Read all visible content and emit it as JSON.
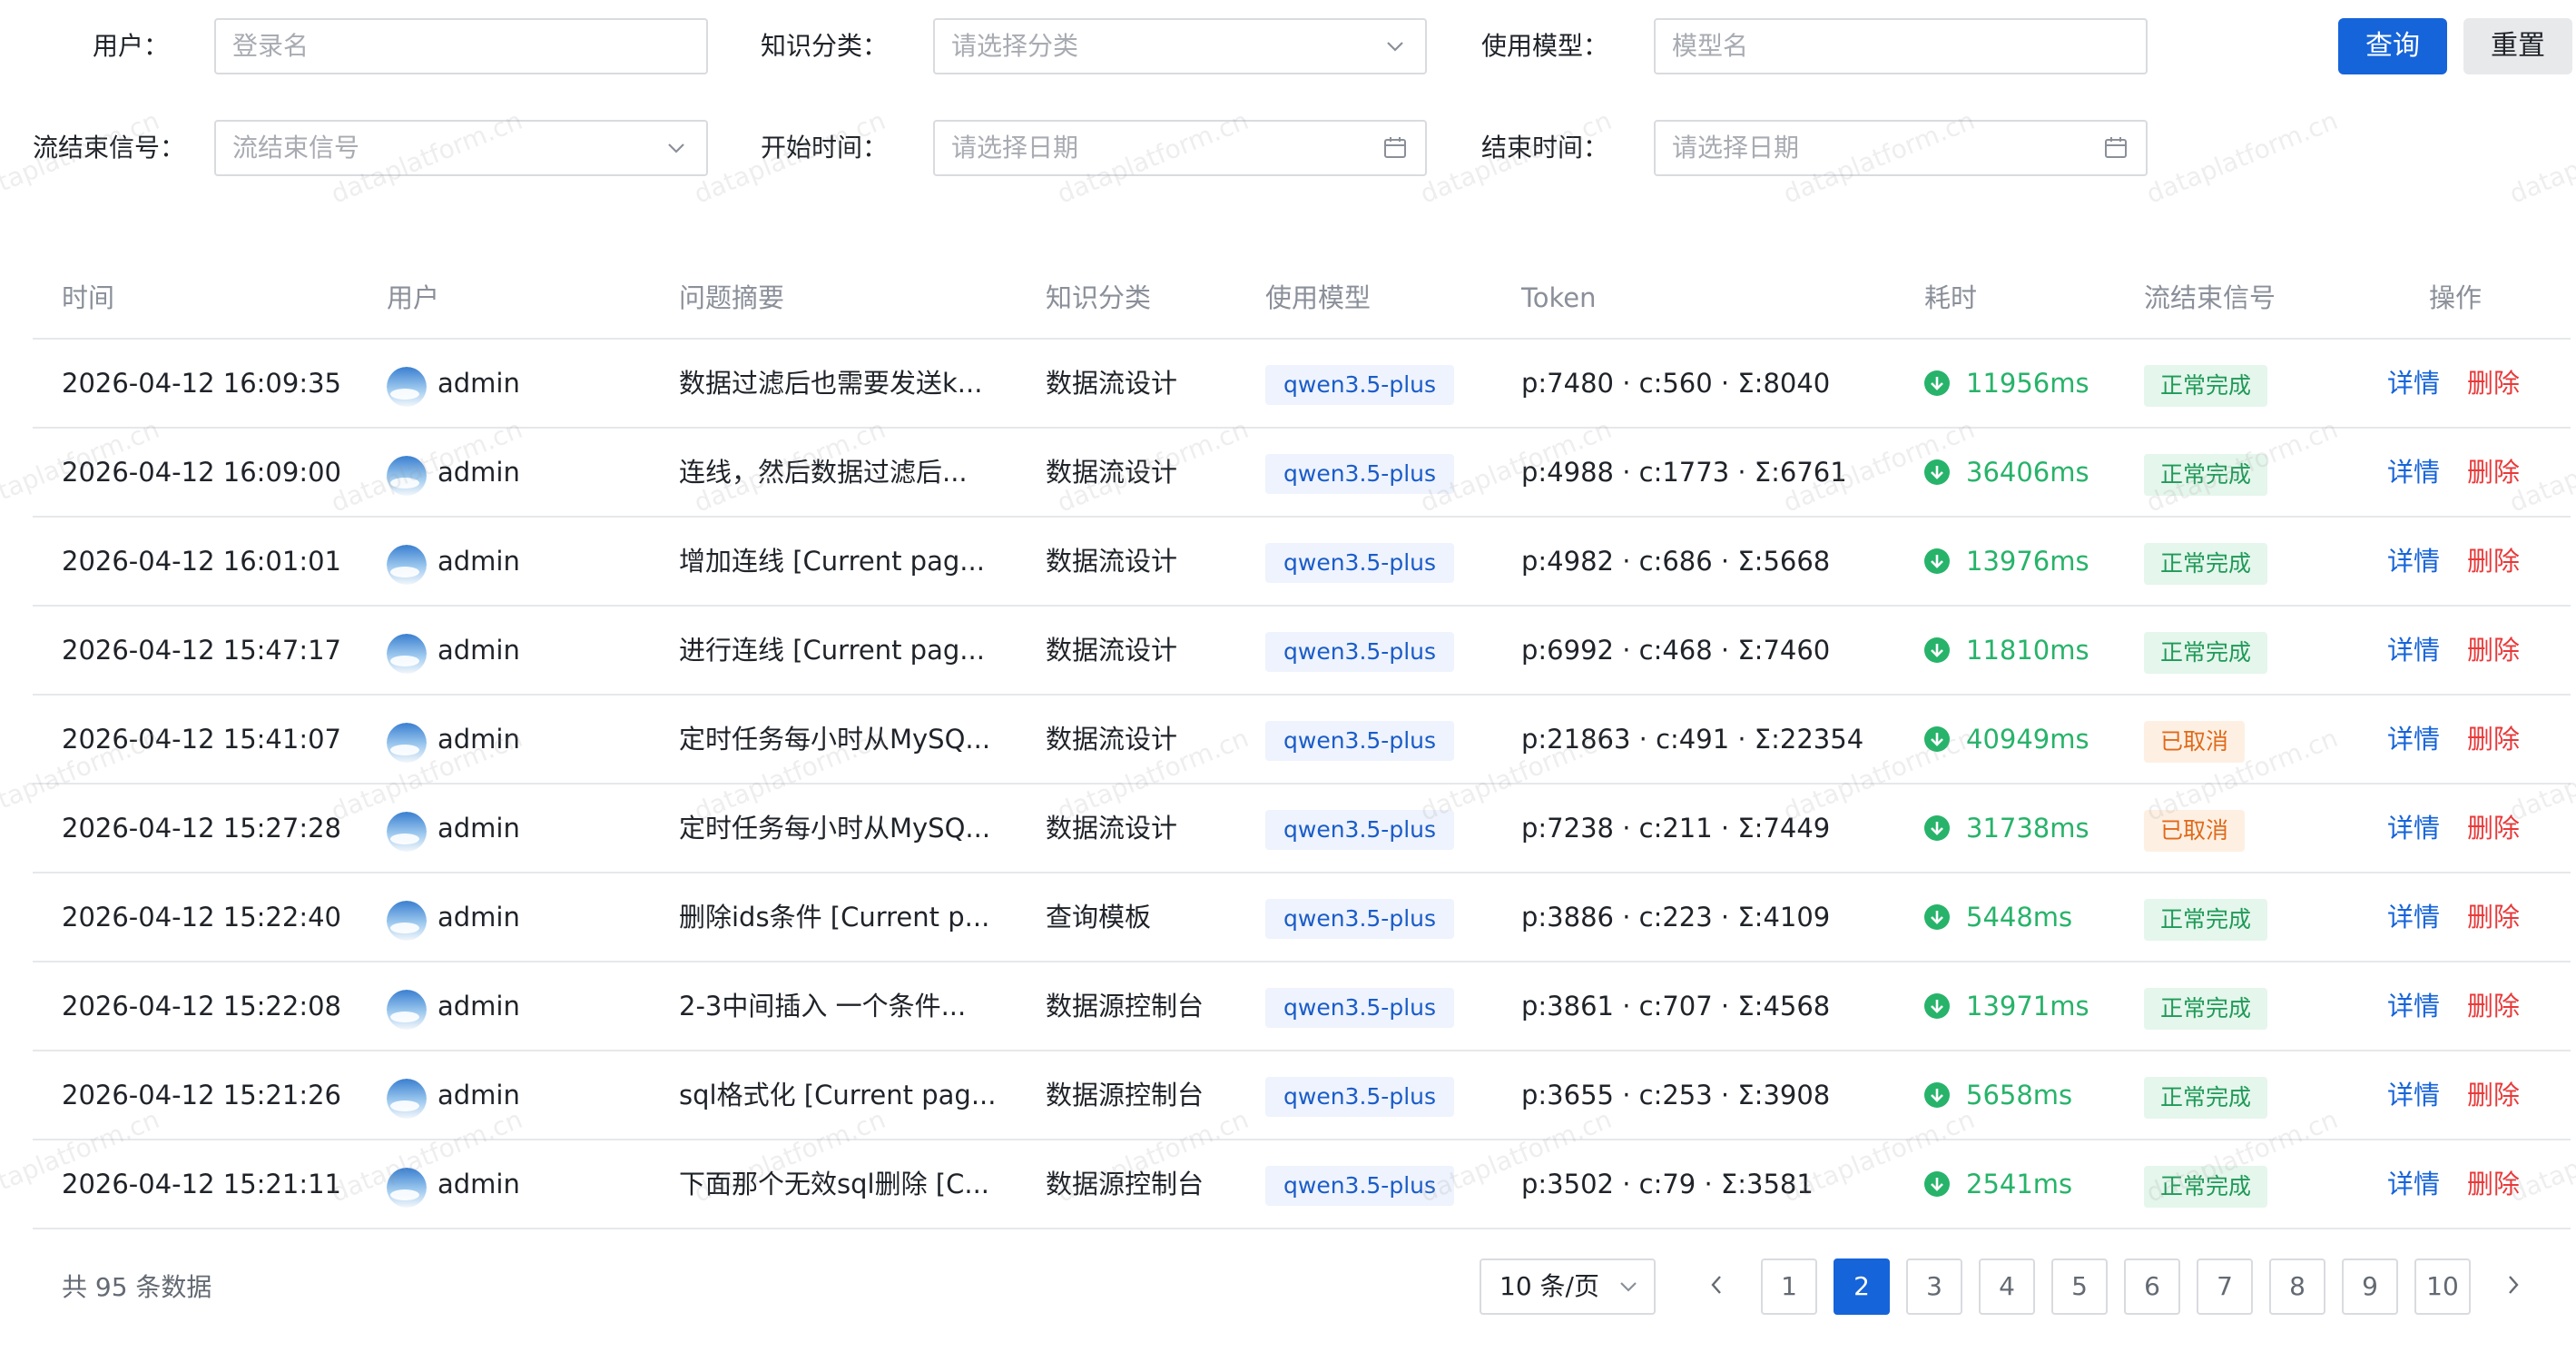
{
  "filters": {
    "user_label": "用户：",
    "user_placeholder": "登录名",
    "category_label": "知识分类：",
    "category_placeholder": "请选择分类",
    "model_label": "使用模型：",
    "model_placeholder": "模型名",
    "query_button": "查询",
    "reset_button": "重置",
    "end_signal_label": "流结束信号：",
    "end_signal_placeholder": "流结束信号",
    "start_time_label": "开始时间：",
    "start_time_placeholder": "请选择日期",
    "end_time_label": "结束时间：",
    "end_time_placeholder": "请选择日期"
  },
  "table": {
    "headers": [
      "时间",
      "用户",
      "问题摘要",
      "知识分类",
      "使用模型",
      "Token",
      "耗时",
      "流结束信号",
      "操作"
    ],
    "action_detail": "详情",
    "action_delete": "删除",
    "rows": [
      {
        "time": "2026-04-12 16:09:35",
        "user": "admin",
        "summary": "数据过滤后也需要发送k...",
        "category": "数据流设计",
        "model": "qwen3.5-plus",
        "token": "p:7480 · c:560 · Σ:8040",
        "duration": "11956ms",
        "status": "正常完成",
        "status_type": "ok"
      },
      {
        "time": "2026-04-12 16:09:00",
        "user": "admin",
        "summary": "连线，然后数据过滤后...",
        "category": "数据流设计",
        "model": "qwen3.5-plus",
        "token": "p:4988 · c:1773 · Σ:6761",
        "duration": "36406ms",
        "status": "正常完成",
        "status_type": "ok"
      },
      {
        "time": "2026-04-12 16:01:01",
        "user": "admin",
        "summary": "增加连线 [Current pag...",
        "category": "数据流设计",
        "model": "qwen3.5-plus",
        "token": "p:4982 · c:686 · Σ:5668",
        "duration": "13976ms",
        "status": "正常完成",
        "status_type": "ok"
      },
      {
        "time": "2026-04-12 15:47:17",
        "user": "admin",
        "summary": "进行连线 [Current pag...",
        "category": "数据流设计",
        "model": "qwen3.5-plus",
        "token": "p:6992 · c:468 · Σ:7460",
        "duration": "11810ms",
        "status": "正常完成",
        "status_type": "ok"
      },
      {
        "time": "2026-04-12 15:41:07",
        "user": "admin",
        "summary": "定时任务每小时从MySQ...",
        "category": "数据流设计",
        "model": "qwen3.5-plus",
        "token": "p:21863 · c:491 · Σ:22354",
        "duration": "40949ms",
        "status": "已取消",
        "status_type": "cancel"
      },
      {
        "time": "2026-04-12 15:27:28",
        "user": "admin",
        "summary": "定时任务每小时从MySQ...",
        "category": "数据流设计",
        "model": "qwen3.5-plus",
        "token": "p:7238 · c:211 · Σ:7449",
        "duration": "31738ms",
        "status": "已取消",
        "status_type": "cancel"
      },
      {
        "time": "2026-04-12 15:22:40",
        "user": "admin",
        "summary": "删除ids条件 [Current p...",
        "category": "查询模板",
        "model": "qwen3.5-plus",
        "token": "p:3886 · c:223 · Σ:4109",
        "duration": "5448ms",
        "status": "正常完成",
        "status_type": "ok"
      },
      {
        "time": "2026-04-12 15:22:08",
        "user": "admin",
        "summary": "2-3中间插入 一个条件...",
        "category": "数据源控制台",
        "model": "qwen3.5-plus",
        "token": "p:3861 · c:707 · Σ:4568",
        "duration": "13971ms",
        "status": "正常完成",
        "status_type": "ok"
      },
      {
        "time": "2026-04-12 15:21:26",
        "user": "admin",
        "summary": "sql格式化 [Current pag...",
        "category": "数据源控制台",
        "model": "qwen3.5-plus",
        "token": "p:3655 · c:253 · Σ:3908",
        "duration": "5658ms",
        "status": "正常完成",
        "status_type": "ok"
      },
      {
        "time": "2026-04-12 15:21:11",
        "user": "admin",
        "summary": "下面那个无效sql删除 [C...",
        "category": "数据源控制台",
        "model": "qwen3.5-plus",
        "token": "p:3502 · c:79 · Σ:3581",
        "duration": "2541ms",
        "status": "正常完成",
        "status_type": "ok"
      }
    ]
  },
  "pagination": {
    "total_text": "共 95 条数据",
    "page_size": "10 条/页",
    "pages": [
      "1",
      "2",
      "3",
      "4",
      "5",
      "6",
      "7",
      "8",
      "9",
      "10"
    ],
    "current_page": "2"
  },
  "watermark": "dataplatform.cn",
  "colors": {
    "primary": "#1664d9",
    "success": "#27b36a",
    "danger": "#e83a3a",
    "warning": "#e06a1a"
  },
  "icons": {
    "select_suffix": "chevron-down-icon",
    "date_suffix": "calendar-icon",
    "duration": "arrow-down-circle-icon",
    "prev": "chevron-left-icon",
    "next": "chevron-right-icon"
  }
}
